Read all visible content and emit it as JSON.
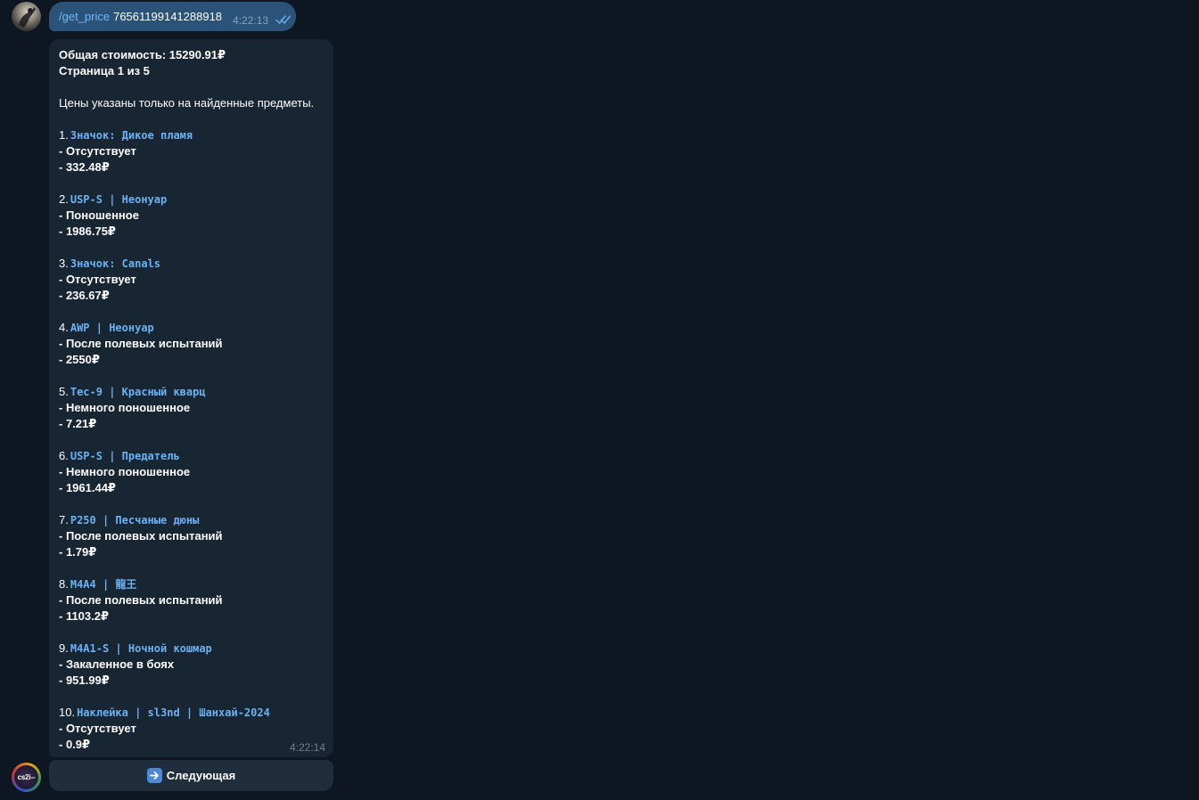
{
  "outgoing": {
    "command": "/get_price",
    "argument": "76561199141288918",
    "time": "4:22:13"
  },
  "bot_avatar": {
    "label": "cs2i--"
  },
  "incoming": {
    "total": "Общая стоимость: 15290.91₽",
    "page": "Страница 1 из 5",
    "note": "Цены указаны только на найденные предметы.",
    "items": [
      {
        "num": "1.",
        "name": "Значок: Дикое пламя",
        "condition": "- Отсутствует",
        "price": "- 332.48₽"
      },
      {
        "num": "2.",
        "name": "USP-S | Неонуар",
        "condition": "- Поношенное",
        "price": "- 1986.75₽"
      },
      {
        "num": "3.",
        "name": "Значок: Canals",
        "condition": "- Отсутствует",
        "price": "- 236.67₽"
      },
      {
        "num": "4.",
        "name": "AWP | Неонуар",
        "condition": "- После полевых испытаний",
        "price": "- 2550₽"
      },
      {
        "num": "5.",
        "name": "Tec-9 | Красный кварц",
        "condition": "- Немного поношенное",
        "price": "- 7.21₽"
      },
      {
        "num": "6.",
        "name": "USP-S | Предатель",
        "condition": "- Немного поношенное",
        "price": "- 1961.44₽"
      },
      {
        "num": "7.",
        "name": "P250 | Песчаные дюны",
        "condition": "- После полевых испытаний",
        "price": "- 1.79₽"
      },
      {
        "num": "8.",
        "name": "M4A4 | 龍王",
        "condition": "- После полевых испытаний",
        "price": "- 1103.2₽"
      },
      {
        "num": "9.",
        "name": "M4A1-S | Ночной кошмар",
        "condition": "- Закаленное в боях",
        "price": "- 951.99₽"
      },
      {
        "num": "10.",
        "name": "Наклейка | sl3nd | Шанхай-2024",
        "condition": "- Отсутствует",
        "price": "- 0.9₽"
      }
    ],
    "time": "4:22:14"
  },
  "keyboard": {
    "next_label": "Следующая",
    "next_icon": "arrow-right-icon"
  },
  "colors": {
    "background": "#0e1621",
    "outgoing_bubble": "#2b5278",
    "incoming_bubble": "#182533",
    "link": "#6ab2f2",
    "button": "#1f2d3c"
  }
}
